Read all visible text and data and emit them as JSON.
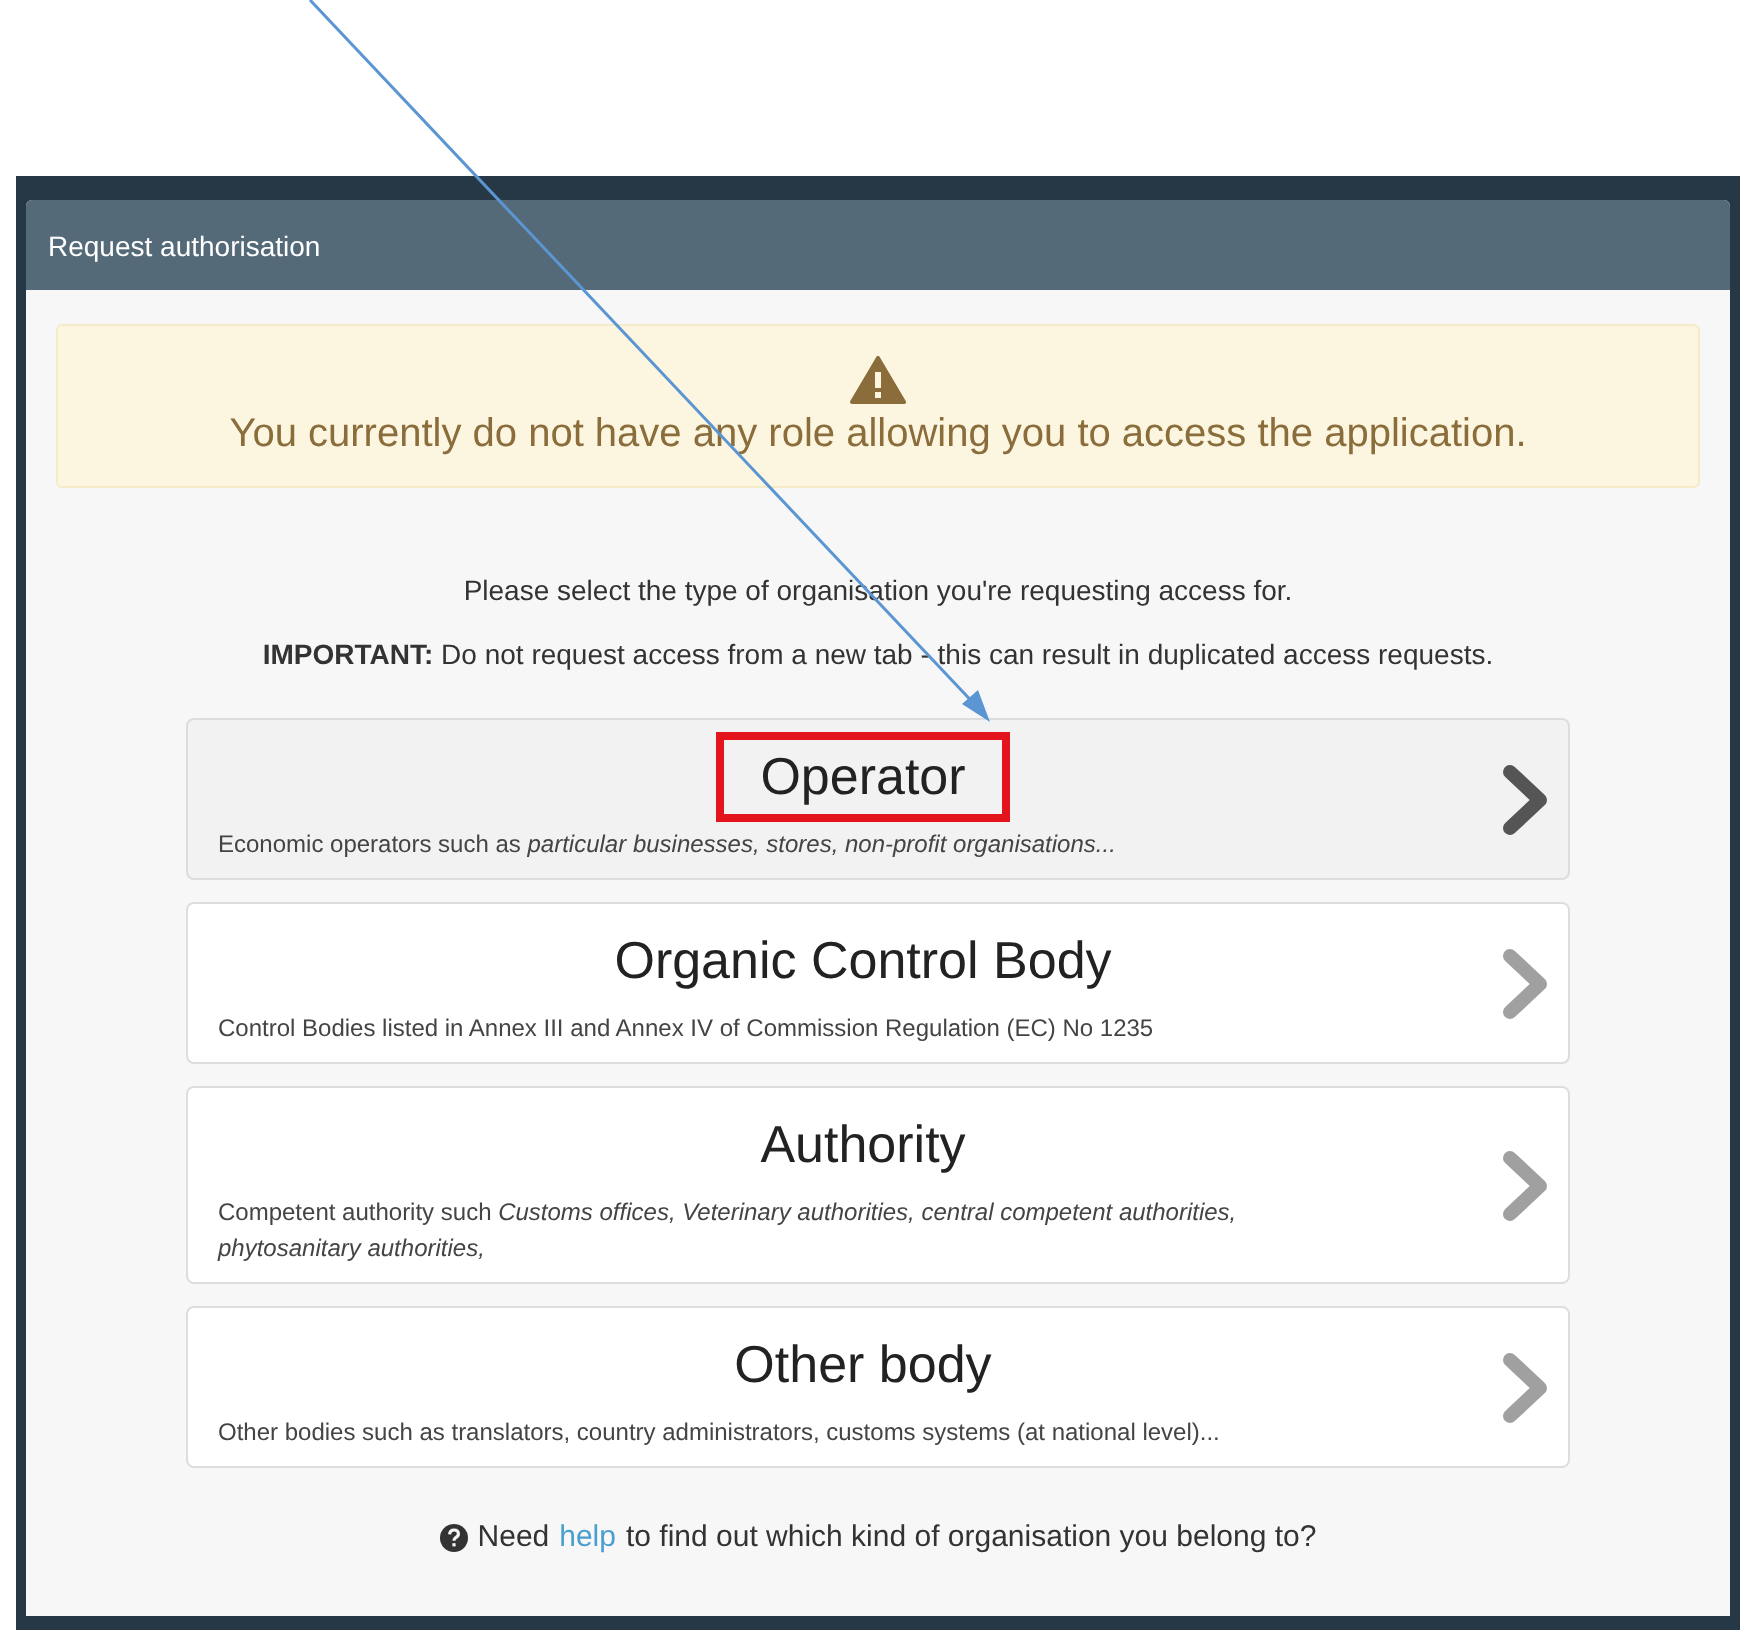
{
  "panel": {
    "title": "Request authorisation"
  },
  "alert": {
    "message": "You currently do not have any role allowing you to access the application."
  },
  "intro": "Please select the type of organisation you're requesting access for.",
  "important": "**IMPORTANT:** Do not request access from a new tab - this can result in duplicated access requests.",
  "options": [
    {
      "title": "Operator",
      "description": "Economic operators such as *particular businesses, stores, non-profit organisations...*",
      "selected": true,
      "highlighted": true
    },
    {
      "title": "Organic Control Body",
      "description": "Control Bodies listed in Annex III and Annex IV of Commission Regulation (EC) No 1235",
      "selected": false,
      "highlighted": false
    },
    {
      "title": "Authority",
      "description": "Competent authority such *Customs offices, Veterinary authorities, central competent authorities, phytosanitary authorities,*",
      "selected": false,
      "highlighted": false
    },
    {
      "title": "Other body",
      "description": "Other bodies such as translators, country administrators, customs systems (at national level)...",
      "selected": false,
      "highlighted": false
    }
  ],
  "help": {
    "before": "Need",
    "link": "help",
    "after": "to find out which kind of organisation you belong to?"
  },
  "annotation": {
    "arrow": true
  }
}
